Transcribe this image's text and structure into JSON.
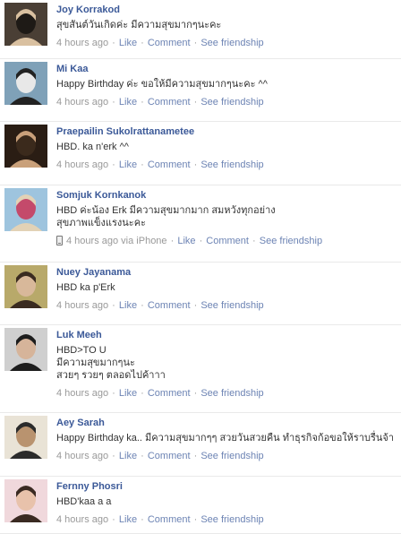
{
  "posts": [
    {
      "author": "Joy Korrakod",
      "message": "สุขสันต์วันเกิดค่ะ มีความสุขมากๆนะคะ",
      "time": "4 hours ago",
      "via": "",
      "actions": [
        "Like",
        "Comment",
        "See friendship"
      ],
      "avatar_colors": [
        "#4a3f35",
        "#d9c0a0",
        "#1e1a16"
      ]
    },
    {
      "author": "Mi Kaa",
      "message": "Happy Birthday ค่ะ ขอให้มีความสุขมากๆนะคะ ^^",
      "time": "4 hours ago",
      "via": "",
      "actions": [
        "Like",
        "Comment",
        "See friendship"
      ],
      "avatar_colors": [
        "#7fa1b8",
        "#222222",
        "#e8e8e8"
      ]
    },
    {
      "author": "Praepailin Sukolrattanametee",
      "message": "HBD. ka n'erk ^^",
      "time": "4 hours ago",
      "via": "",
      "actions": [
        "Like",
        "Comment",
        "See friendship"
      ],
      "avatar_colors": [
        "#2a1d14",
        "#c9a07a",
        "#3b2a1c"
      ]
    },
    {
      "author": "Somjuk Kornkanok",
      "message": "HBD ค่ะน้อง Erk มีความสุขมากมาก สมหวังทุกอย่าง\nสุขภาพแข็งแรงนะคะ",
      "time": "4 hours ago",
      "via": "via iPhone",
      "actions": [
        "Like",
        "Comment",
        "See friendship"
      ],
      "avatar_colors": [
        "#9ec4de",
        "#e2d2b6",
        "#c44a6b"
      ]
    },
    {
      "author": "Nuey Jayanama",
      "message": "HBD ka p'Erk",
      "time": "4 hours ago",
      "via": "",
      "actions": [
        "Like",
        "Comment",
        "See friendship"
      ],
      "avatar_colors": [
        "#b8a96a",
        "#3a2b20",
        "#d8b89a"
      ]
    },
    {
      "author": "Luk Meeh",
      "message": "HBD>TO U\nมีความสุขมากๆนะ\nสวยๆ รวยๆ ตลอดไปค้าาา",
      "time": "4 hours ago",
      "via": "",
      "actions": [
        "Like",
        "Comment",
        "See friendship"
      ],
      "avatar_colors": [
        "#cfcfcf",
        "#1d1d1d",
        "#d6b49a"
      ]
    },
    {
      "author": "Aey Sarah",
      "message": "Happy Birthday ka.. มีความสุขมากๆๆ สวยวันสวยคืน ทำธุรกิจก้อขอให้ราบรื่นจ้า",
      "time": "4 hours ago",
      "via": "",
      "actions": [
        "Like",
        "Comment",
        "See friendship"
      ],
      "avatar_colors": [
        "#e9e3d6",
        "#2b2b2b",
        "#b9936f"
      ]
    },
    {
      "author": "Fernny Phosri",
      "message": "HBD'kaa a a",
      "time": "4 hours ago",
      "via": "",
      "actions": [
        "Like",
        "Comment",
        "See friendship"
      ],
      "avatar_colors": [
        "#f0d8dc",
        "#3a2a22",
        "#e8c2ab"
      ]
    }
  ]
}
